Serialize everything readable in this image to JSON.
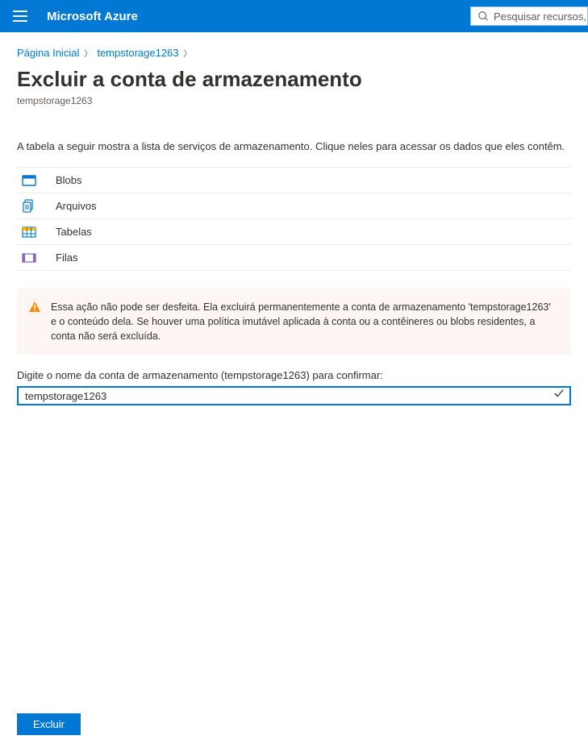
{
  "header": {
    "brand": "Microsoft Azure",
    "search_placeholder": "Pesquisar recursos, servi"
  },
  "breadcrumb": {
    "home": "Página Inicial",
    "resource": "tempstorage1263"
  },
  "page": {
    "title": "Excluir a conta de armazenamento",
    "subtitle": "tempstorage1263",
    "intro": "A tabela a seguir mostra a lista de serviços de armazenamento. Clique neles para acessar os dados que eles contêm."
  },
  "services": {
    "blobs": "Blobs",
    "files": "Arquivos",
    "tables": "Tabelas",
    "queues": "Filas"
  },
  "warning": {
    "text": "Essa ação não pode ser desfeita. Ela excluirá permanentemente a conta de armazenamento 'tempstorage1263' e o conteúdo dela. Se houver uma política imutável aplicada à conta ou a contêineres ou blobs residentes, a conta não será excluída."
  },
  "confirm": {
    "label": "Digite o nome da conta de armazenamento (tempstorage1263) para confirmar:",
    "value": "tempstorage1263"
  },
  "actions": {
    "delete": "Excluir"
  }
}
